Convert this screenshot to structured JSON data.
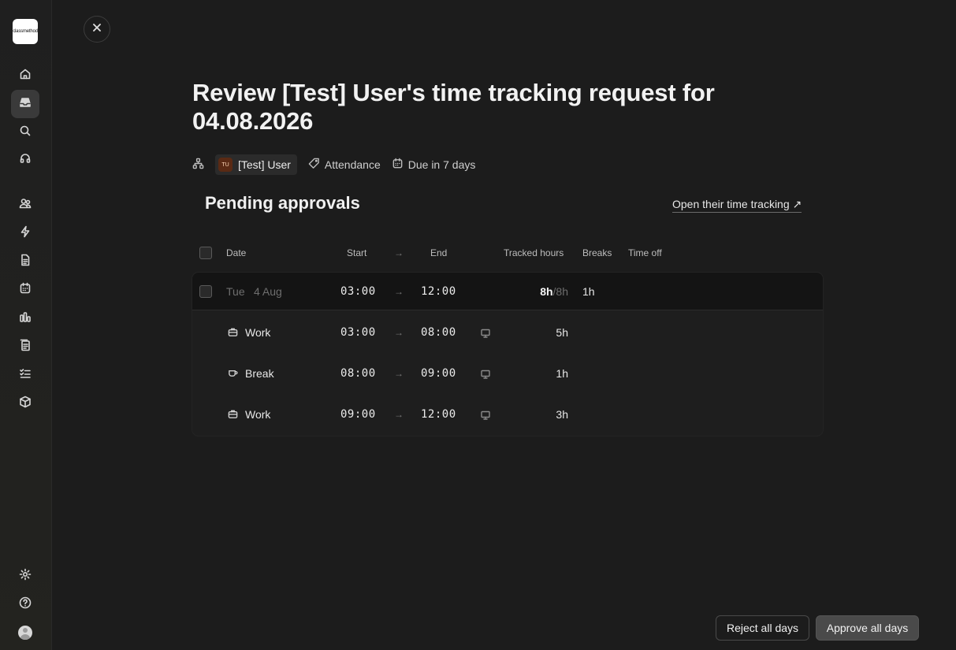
{
  "sidebar": {
    "logo_text": "classmethod",
    "items": [
      {
        "name": "home-icon"
      },
      {
        "name": "inbox-icon",
        "active": true
      },
      {
        "name": "search-icon"
      },
      {
        "name": "support-icon"
      },
      {
        "name": "people-icon"
      },
      {
        "name": "bolt-icon"
      },
      {
        "name": "document-icon"
      },
      {
        "name": "calendar-icon"
      },
      {
        "name": "chart-icon"
      },
      {
        "name": "ledger-icon"
      },
      {
        "name": "checklist-icon"
      },
      {
        "name": "package-icon"
      }
    ],
    "bottom": [
      {
        "name": "gear-icon"
      },
      {
        "name": "help-icon"
      }
    ]
  },
  "header": {
    "title": "Review [Test] User's time tracking request for 04.08.2026"
  },
  "meta": {
    "user_initials": "TU",
    "user_name": "[Test] User",
    "category": "Attendance",
    "due": "Due in 7 days"
  },
  "section": {
    "title": "Pending approvals",
    "open_link": "Open their time tracking ↗"
  },
  "table": {
    "columns": {
      "date": "Date",
      "start": "Start",
      "arrow": "→",
      "end": "End",
      "tracked": "Tracked hours",
      "breaks": "Breaks",
      "timeoff": "Time off"
    },
    "day_row": {
      "weekday": "Tue",
      "date": "4 Aug",
      "start": "03:00",
      "end": "12:00",
      "tracked": "8h",
      "target": "/8h",
      "breaks": "1h"
    },
    "entries": [
      {
        "type": "Work",
        "icon": "briefcase-icon",
        "start": "03:00",
        "end": "08:00",
        "hours": "5h"
      },
      {
        "type": "Break",
        "icon": "coffee-icon",
        "start": "08:00",
        "end": "09:00",
        "hours": "1h"
      },
      {
        "type": "Work",
        "icon": "briefcase-icon",
        "start": "09:00",
        "end": "12:00",
        "hours": "3h"
      }
    ]
  },
  "footer": {
    "reject_label": "Reject all days",
    "approve_label": "Approve all days"
  }
}
